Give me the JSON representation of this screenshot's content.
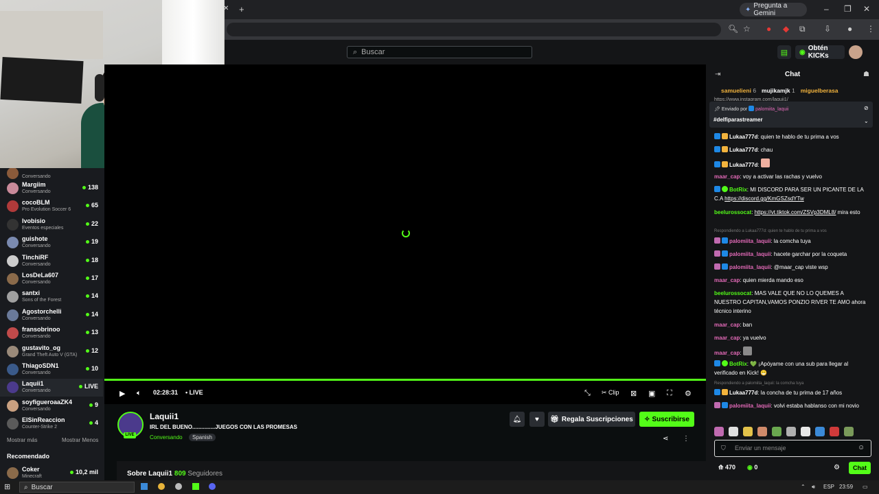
{
  "browser": {
    "gemini_label": "Pregunta a Gemini"
  },
  "header": {
    "search_placeholder": "Buscar",
    "kicks_label": "Obtén KICKs"
  },
  "sidebar": {
    "items": [
      {
        "name": "",
        "sub": "Conversando",
        "count": ""
      },
      {
        "name": "Margiim",
        "sub": "Conversando",
        "count": "138"
      },
      {
        "name": "cocoBLM",
        "sub": "Pro Evolution Soccer 6",
        "count": "65"
      },
      {
        "name": "lvobisio",
        "sub": "Eventos especiales",
        "count": "22"
      },
      {
        "name": "guishote",
        "sub": "Conversando",
        "count": "19"
      },
      {
        "name": "TinchiRF",
        "sub": "Conversando",
        "count": "18"
      },
      {
        "name": "LosDeLa607",
        "sub": "Conversando",
        "count": "17"
      },
      {
        "name": "santxi",
        "sub": "Sons of the Forest",
        "count": "14"
      },
      {
        "name": "Agostorchelli",
        "sub": "Conversando",
        "count": "14"
      },
      {
        "name": "fransobrinoo",
        "sub": "Conversando",
        "count": "13"
      },
      {
        "name": "gustavito_og",
        "sub": "Grand Theft Auto V (GTA)",
        "count": "12"
      },
      {
        "name": "ThiagoSDN1",
        "sub": "Conversando",
        "count": "10"
      },
      {
        "name": "Laquii1",
        "sub": "Conversando",
        "count": "LIVE"
      },
      {
        "name": "soyfigueroaaZK4",
        "sub": "Conversando",
        "count": "9"
      },
      {
        "name": "ElSinReaccion",
        "sub": "Counter-Strike 2",
        "count": "4"
      }
    ],
    "show_more": "Mostrar más",
    "show_less": "Mostrar Menos",
    "recommended_title": "Recomendado",
    "recommended": {
      "name": "Coker",
      "sub": "Minecraft",
      "count": "10,2 mil"
    }
  },
  "player": {
    "time": "02:28:31",
    "live_label": "LIVE",
    "clip_label": "Clip"
  },
  "stream": {
    "streamer": "Laquii1",
    "live_badge": "LIVE",
    "title": "IRL DEL BUENO...............JUEGOS CON LAS PROMESAS",
    "category": "Conversando",
    "tag": "Spanish",
    "gift_label": "Regala Suscripciones",
    "subscribe_label": "Suscribirse",
    "about_prefix": "Sobre Laquii1",
    "followers": "809",
    "followers_label": "Seguidores"
  },
  "chat": {
    "title": "Chat",
    "gifters": [
      {
        "name": "samuelieni",
        "count": "6",
        "color": "#f2b33d"
      },
      {
        "name": "mujikamjk",
        "count": "1",
        "color": "#ffffff"
      },
      {
        "name": "miguelberasa",
        "count": "",
        "color": "#f2b33d"
      }
    ],
    "cut_line": "https://www.instagram.com/laquii1/",
    "pinned_by_prefix": "Enviado por",
    "pinned_by": "palomiita_laquii",
    "pinned_text": "#delfiparastreamer",
    "messages": [
      {
        "user": "Lukaa777d",
        "text": ": quien te hablo de tu prima a vos",
        "color": "#ffffff"
      },
      {
        "user": "Lukaa777d",
        "text": ": chau",
        "color": "#ffffff"
      },
      {
        "user": "Lukaa777d",
        "text": ":",
        "color": "#ffffff"
      },
      {
        "user": "maar_cap",
        "text": ": voy a activar las rachas y vuelvo",
        "color": "#e36ab8"
      },
      {
        "user": "BotRix",
        "text": ": MI DISCORD PARA SER UN PICANTE DE LA C.A ",
        "link": "https://discord.gg/KmGSZsdYTw",
        "color": "#53fc18"
      },
      {
        "user": "beelurossocat",
        "text": " mira esto",
        "link": "https://vt.tiktok.com/ZSVp3DML8/",
        "color": "#53fc18"
      },
      {
        "user": "palomiita_laquii",
        "text": ": la comcha tuya",
        "color": "#e36ab8"
      },
      {
        "user": "palomiita_laquii",
        "text": ": hacete garchar por la coqueta",
        "color": "#e36ab8"
      },
      {
        "user": "palomiita_laquii",
        "text": ": @maar_cap viste wsp",
        "color": "#e36ab8"
      },
      {
        "user": "maar_cap",
        "text": ": quien mierda mando eso",
        "color": "#e36ab8"
      },
      {
        "user": "beelurossocat",
        "text": ": MAS VALE QUE NO LO QUEMES A NUESTRO CAPITAN,VAMOS PONZIO RIVER TE AMO ahora técnico interino",
        "color": "#53fc18"
      },
      {
        "user": "maar_cap",
        "text": ": ban",
        "color": "#e36ab8"
      },
      {
        "user": "maar_cap",
        "text": ": ya vuelvo",
        "color": "#e36ab8"
      },
      {
        "user": "maar_cap",
        "text": ":",
        "color": "#e36ab8"
      },
      {
        "user": "BotRix",
        "text": ": 💚 ¡Apóyame con una sub para llegar al verificado en Kick! 😁",
        "color": "#53fc18"
      },
      {
        "user": "Lukaa777d",
        "text": ": la concha de tu prima de 17 años",
        "color": "#ffffff"
      },
      {
        "user": "palomiita_laquii",
        "text": ": volvi estaba hablanso con mi novio",
        "color": "#e36ab8"
      }
    ],
    "reply1": "Respondiendo a Lukaa777d: quien te hablo de tu prima a vos",
    "reply2": "Respondiendo a palomiita_laquii: la comcha tuya",
    "input_placeholder": "Enviar un mensaje",
    "kicks_count": "470",
    "points": "0",
    "send_label": "Chat"
  },
  "taskbar": {
    "search": "Buscar",
    "lang": "ESP",
    "time": "23:59"
  },
  "colors": {
    "accent": "#53fc18",
    "bg": "#0b0e0f",
    "panel": "#141517"
  }
}
